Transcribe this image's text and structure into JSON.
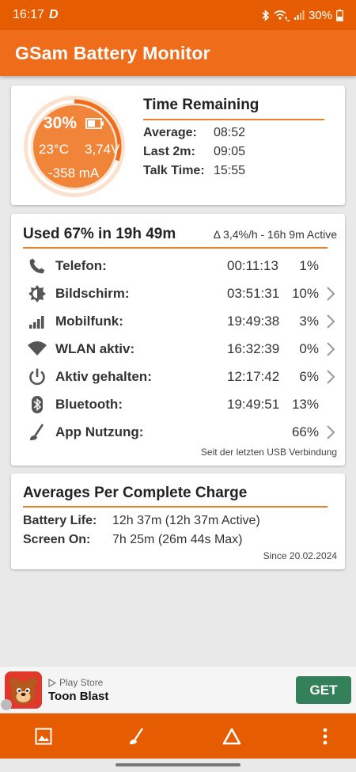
{
  "status_bar": {
    "time": "16:17",
    "carrier_glyph": "D",
    "battery_percent": "30%",
    "icons": [
      "bluetooth-icon",
      "wifi-calling-icon",
      "signal-icon",
      "battery-icon"
    ]
  },
  "app_bar": {
    "title": "GSam Battery Monitor"
  },
  "time_remaining": {
    "gauge_level": 0.3,
    "percent": "30%",
    "temperature": "23°C",
    "voltage": "3,74V",
    "current": "-358 mA",
    "title": "Time Remaining",
    "rows": [
      {
        "label": "Average:",
        "value": "08:52"
      },
      {
        "label": "Last 2m:",
        "value": "09:05"
      },
      {
        "label": "Talk Time:",
        "value": "15:55"
      }
    ]
  },
  "usage": {
    "title": "Used 67% in 19h 49m",
    "rate": "Δ 3,4%/h - 16h 9m Active",
    "rows": [
      {
        "icon": "phone-icon",
        "label": "Telefon:",
        "time": "00:11:13",
        "percent": "1%",
        "chevron": false
      },
      {
        "icon": "brightness-icon",
        "label": "Bildschirm:",
        "time": "03:51:31",
        "percent": "10%",
        "chevron": true
      },
      {
        "icon": "cell-signal-icon",
        "label": "Mobilfunk:",
        "time": "19:49:38",
        "percent": "3%",
        "chevron": true
      },
      {
        "icon": "wifi-icon",
        "label": "WLAN aktiv:",
        "time": "16:32:39",
        "percent": "0%",
        "chevron": true
      },
      {
        "icon": "power-icon",
        "label": "Aktiv gehalten:",
        "time": "12:17:42",
        "percent": "6%",
        "chevron": true
      },
      {
        "icon": "bluetooth-icon",
        "label": "Bluetooth:",
        "time": "19:49:51",
        "percent": "13%",
        "chevron": false
      },
      {
        "icon": "app-usage-icon",
        "label": "App Nutzung:",
        "time": "",
        "percent": "66%",
        "chevron": true
      }
    ],
    "footnote": "Seit der letzten USB Verbindung"
  },
  "averages": {
    "title": "Averages Per Complete Charge",
    "rows": [
      {
        "label": "Battery Life:",
        "value": "12h 37m (12h 37m Active)"
      },
      {
        "label": "Screen On:",
        "value": "7h 25m (26m 44s Max)"
      }
    ],
    "since": "Since 20.02.2024"
  },
  "ad": {
    "store": "Play Store",
    "app_name": "Toon Blast",
    "cta": "GET"
  },
  "bottom_nav": {
    "items": [
      "image-icon",
      "app-usage-icon",
      "delta-icon",
      "more-vert-icon"
    ]
  },
  "colors": {
    "primary": "#ef6c1a",
    "status_bar": "#e65c00",
    "accent_line": "#e8822a",
    "gauge_fill": "#f0853a",
    "ad_button": "#34805a"
  }
}
